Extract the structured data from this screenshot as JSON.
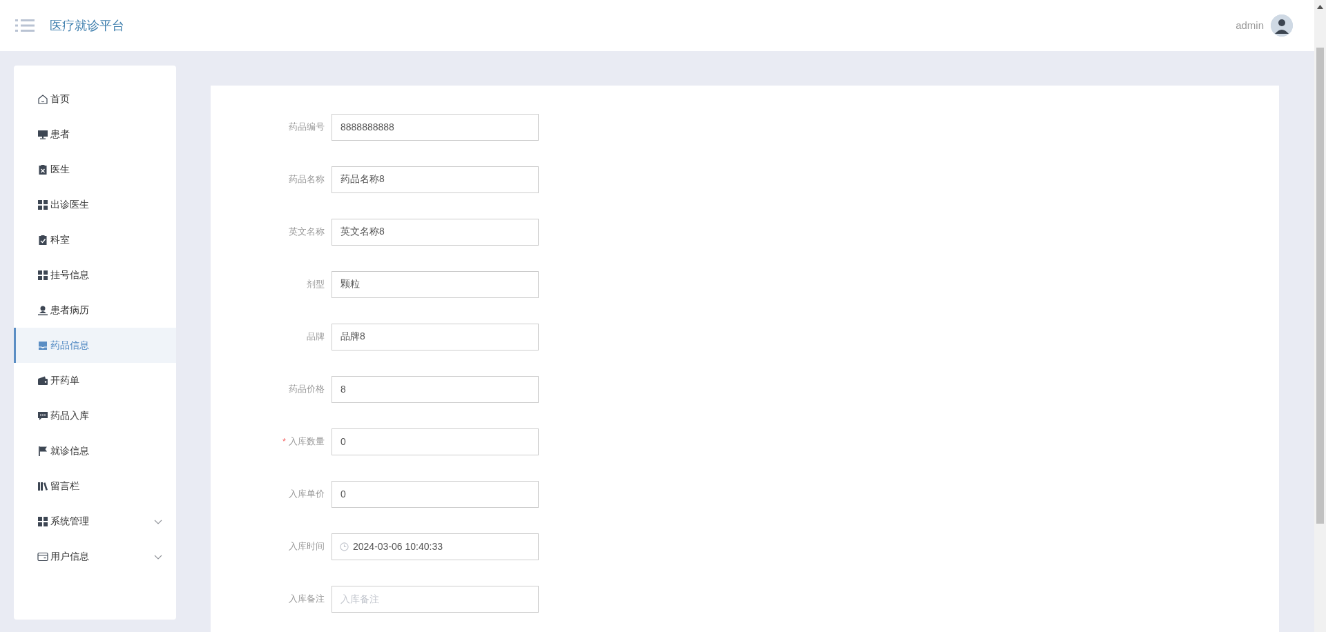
{
  "header": {
    "title": "医疗就诊平台",
    "user": "admin"
  },
  "sidebar": {
    "items": [
      {
        "label": "首页",
        "selected": false,
        "expandable": false
      },
      {
        "label": "患者",
        "selected": false,
        "expandable": false
      },
      {
        "label": "医生",
        "selected": false,
        "expandable": false
      },
      {
        "label": "出诊医生",
        "selected": false,
        "expandable": false
      },
      {
        "label": "科室",
        "selected": false,
        "expandable": false
      },
      {
        "label": "挂号信息",
        "selected": false,
        "expandable": false
      },
      {
        "label": "患者病历",
        "selected": false,
        "expandable": false
      },
      {
        "label": "药品信息",
        "selected": true,
        "expandable": false
      },
      {
        "label": "开药单",
        "selected": false,
        "expandable": false
      },
      {
        "label": "药品入库",
        "selected": false,
        "expandable": false
      },
      {
        "label": "就诊信息",
        "selected": false,
        "expandable": false
      },
      {
        "label": "留言栏",
        "selected": false,
        "expandable": false
      },
      {
        "label": "系统管理",
        "selected": false,
        "expandable": true
      },
      {
        "label": "用户信息",
        "selected": false,
        "expandable": true
      }
    ]
  },
  "form": {
    "required_mark": "*",
    "fields": [
      {
        "kind": "text",
        "label": "药品编号",
        "value": "8888888888",
        "required": false
      },
      {
        "kind": "text",
        "label": "药品名称",
        "value": "药品名称8",
        "required": false
      },
      {
        "kind": "text",
        "label": "英文名称",
        "value": "英文名称8",
        "required": false
      },
      {
        "kind": "text",
        "label": "剂型",
        "value": "颗粒",
        "required": false
      },
      {
        "kind": "text",
        "label": "品牌",
        "value": "品牌8",
        "required": false
      },
      {
        "kind": "text",
        "label": "药品价格",
        "value": "8",
        "required": false
      },
      {
        "kind": "text",
        "label": "入库数量",
        "value": "0",
        "required": true
      },
      {
        "kind": "text",
        "label": "入库单价",
        "value": "0",
        "required": false
      },
      {
        "kind": "datetime",
        "label": "入库时间",
        "value": "2024-03-06 10:40:33",
        "required": false
      },
      {
        "kind": "text",
        "label": "入库备注",
        "placeholder": "入库备注",
        "required": false
      }
    ]
  }
}
